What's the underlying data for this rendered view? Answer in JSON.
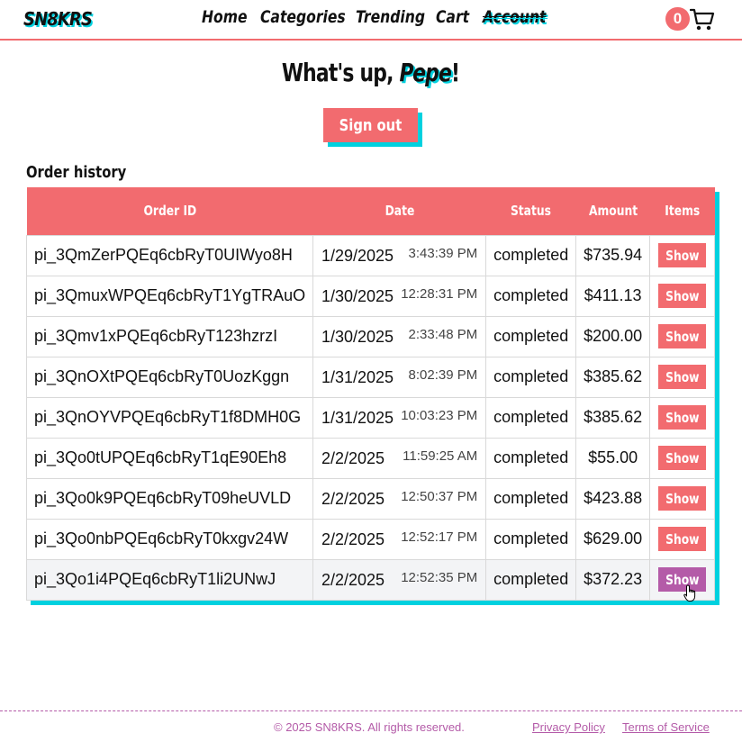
{
  "header": {
    "logo": "SN8KRS",
    "nav": {
      "home": "Home",
      "categories": "Categories",
      "trending": "Trending",
      "cart": "Cart",
      "account": "Account"
    },
    "cart_count": "0",
    "cart_icon": "shopping-cart-icon"
  },
  "greeting": {
    "prefix": "What's up, ",
    "name": "Pepe",
    "suffix": "!"
  },
  "signout_label": "Sign out",
  "order_history": {
    "title": "Order history",
    "columns": [
      "Order ID",
      "Date",
      "Status",
      "Amount",
      "Items"
    ],
    "button_label": "Show",
    "rows": [
      {
        "id": "pi_3QmZerPQEq6cbRyT0UIWyo8H",
        "date": "1/29/2025",
        "time": "3:43:39 PM",
        "status": "completed",
        "amount": "$735.94"
      },
      {
        "id": "pi_3QmuxWPQEq6cbRyT1YgTRAuO",
        "date": "1/30/2025",
        "time": "12:28:31 PM",
        "status": "completed",
        "amount": "$411.13"
      },
      {
        "id": "pi_3Qmv1xPQEq6cbRyT123hzrzI",
        "date": "1/30/2025",
        "time": "2:33:48 PM",
        "status": "completed",
        "amount": "$200.00"
      },
      {
        "id": "pi_3QnOXtPQEq6cbRyT0UozKggn",
        "date": "1/31/2025",
        "time": "8:02:39 PM",
        "status": "completed",
        "amount": "$385.62"
      },
      {
        "id": "pi_3QnOYVPQEq6cbRyT1f8DMH0G",
        "date": "1/31/2025",
        "time": "10:03:23 PM",
        "status": "completed",
        "amount": "$385.62"
      },
      {
        "id": "pi_3Qo0tUPQEq6cbRyT1qE90Eh8",
        "date": "2/2/2025",
        "time": "11:59:25 AM",
        "status": "completed",
        "amount": "$55.00"
      },
      {
        "id": "pi_3Qo0k9PQEq6cbRyT09heUVLD",
        "date": "2/2/2025",
        "time": "12:50:37 PM",
        "status": "completed",
        "amount": "$423.88"
      },
      {
        "id": "pi_3Qo0nbPQEq6cbRyT0kxgv24W",
        "date": "2/2/2025",
        "time": "12:52:17 PM",
        "status": "completed",
        "amount": "$629.00"
      },
      {
        "id": "pi_3Qo1i4PQEq6cbRyT1li2UNwJ",
        "date": "2/2/2025",
        "time": "12:52:35 PM",
        "status": "completed",
        "amount": "$372.23"
      }
    ]
  },
  "footer": {
    "copyright": "© 2025 SN8KRS. All rights reserved.",
    "privacy": "Privacy Policy",
    "terms": "Terms of Service"
  },
  "colors": {
    "accent": "#f26b6f",
    "shadow": "#00d1df",
    "hover": "#b45ba8"
  }
}
